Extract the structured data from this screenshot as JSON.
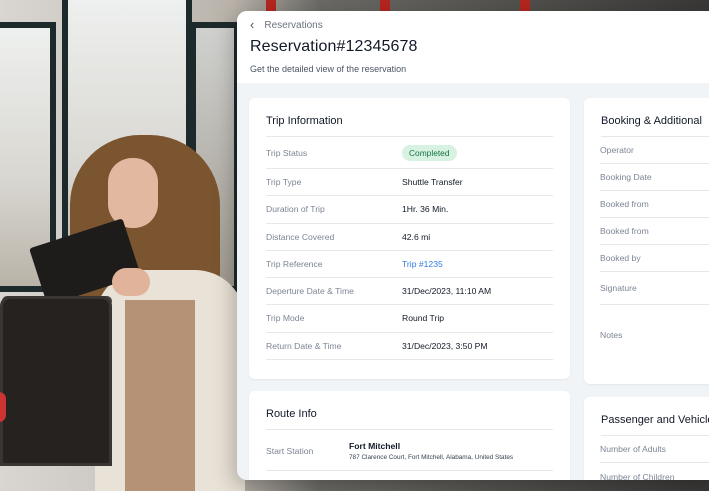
{
  "header": {
    "breadcrumb": "Reservations",
    "title": "Reservation#12345678",
    "subtitle": "Get the detailed view of the reservation"
  },
  "trip": {
    "title": "Trip Information",
    "rows": [
      {
        "label": "Trip Status",
        "value": "Completed"
      },
      {
        "label": "Trip Type",
        "value": "Shuttle Transfer"
      },
      {
        "label": "Duration of Trip",
        "value": "1Hr. 36 Min."
      },
      {
        "label": "Distance Covered",
        "value": "42.6 mi"
      },
      {
        "label": "Trip Reference",
        "value": "Trip #1235"
      },
      {
        "label": "Deperture Date & Time",
        "value": "31/Dec/2023, 11:10 AM"
      },
      {
        "label": "Trip Mode",
        "value": "Round Trip"
      },
      {
        "label": "Return Date & Time",
        "value": "31/Dec/2023, 3:50 PM"
      }
    ]
  },
  "route": {
    "title": "Route Info",
    "start_label": "Start Station",
    "start_name": "Fort Mitchell",
    "start_address": "787 Clarence Court, Fort Mitchell, Alabama, United States"
  },
  "booking": {
    "title": "Booking & Additional",
    "rows": [
      "Operator",
      "Booking Date",
      "Booked from",
      "Booked from",
      "Booked by",
      "Signature",
      "Notes"
    ]
  },
  "passenger": {
    "title": "Passenger and Vehicle",
    "rows": [
      "Number of Adults",
      "Number of Children"
    ]
  },
  "colors": {
    "status_bg": "#d7f2e1",
    "status_text": "#177245",
    "link": "#2f7be0"
  }
}
